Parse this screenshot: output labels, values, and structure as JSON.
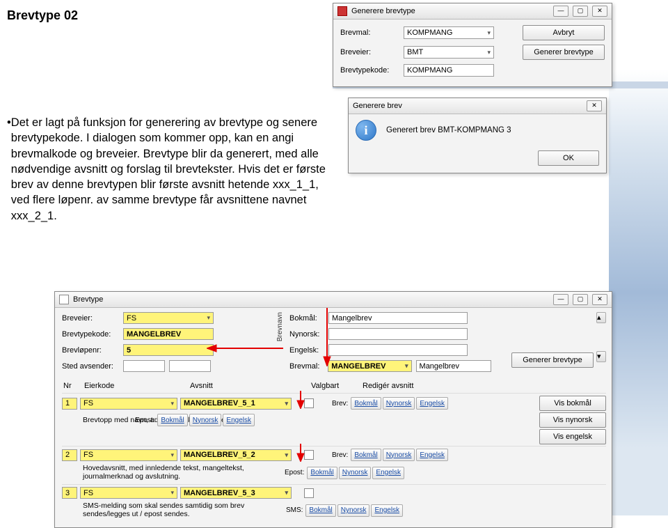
{
  "page": {
    "title": "Brevtype 02"
  },
  "paragraph": {
    "bullet_lines": "Det er lagt på funksjon for generering av brevtype og senere brevtypekode. I dialogen som kommer opp, kan en angi brevmalkode og breveier. Brevtype blir da generert, med alle nødvendige avsnitt og forslag til brevtekster. Hvis det er første brev av denne brevtypen blir første avsnitt hetende xxx_1_1, ved flere løpenr. av samme brevtype får avsnittene navnet xxx_2_1."
  },
  "dlg1": {
    "title": "Generere brevtype",
    "labels": {
      "brevmal": "Brevmal:",
      "breveier": "Breveier:",
      "brevtypekode": "Brevtypekode:"
    },
    "values": {
      "brevmal": "KOMPMANG",
      "breveier": "BMT",
      "brevtypekode": "KOMPMANG"
    },
    "buttons": {
      "avbryt": "Avbryt",
      "generer": "Generer brevtype"
    }
  },
  "dlg2": {
    "title": "Generere brev",
    "message": "Generert brev BMT-KOMPMANG 3",
    "ok": "OK"
  },
  "brevtype": {
    "title": "Brevtype",
    "labels": {
      "breveier": "Breveier:",
      "brevtypekode": "Brevtypekode:",
      "brevlopennr": "Brevløpenr:",
      "sted_avsender": "Sted avsender:",
      "brevnavn_group": "Brevnavn",
      "bokmaal": "Bokmål:",
      "nynorsk": "Nynorsk:",
      "engelsk": "Engelsk:",
      "brevmal": "Brevmal:",
      "generer": "Generer brevtype"
    },
    "values": {
      "breveier": "FS",
      "brevtypekode": "MANGELBREV",
      "brevlopennr": "5",
      "sted_avsender": "",
      "bokmaal": "Mangelbrev",
      "nynorsk": "",
      "engelsk": "",
      "brevmal": "MANGELBREV",
      "brevmal2": "Mangelbrev"
    },
    "columns": {
      "nr": "Nr",
      "eierkode": "Eierkode",
      "avsnitt": "Avsnitt",
      "valgbart": "Valgbart",
      "rediger": "Redigér avsnitt"
    },
    "lang": {
      "bokmaal": "Bokmål",
      "nynorsk": "Nynorsk",
      "engelsk": "Engelsk"
    },
    "brev_label": "Brev:",
    "epost_label": "Epost:",
    "sms_label": "SMS:",
    "vis": {
      "bokmaal": "Vis bokmål",
      "nynorsk": "Vis nynorsk",
      "engelsk": "Vis engelsk"
    },
    "rows": [
      {
        "nr": "1",
        "eierkode": "FS",
        "avsnitt": "MANGELBREV_5_1",
        "desc": "Brevtopp med navn, adresse, saksbehandlerinfo etc."
      },
      {
        "nr": "2",
        "eierkode": "FS",
        "avsnitt": "MANGELBREV_5_2",
        "desc": "Hovedavsnitt, med innledende tekst, mangeltekst, journalmerknad og avslutning."
      },
      {
        "nr": "3",
        "eierkode": "FS",
        "avsnitt": "MANGELBREV_5_3",
        "desc": "SMS-melding som skal sendes samtidig som brev sendes/legges ut / epost sendes."
      }
    ]
  }
}
